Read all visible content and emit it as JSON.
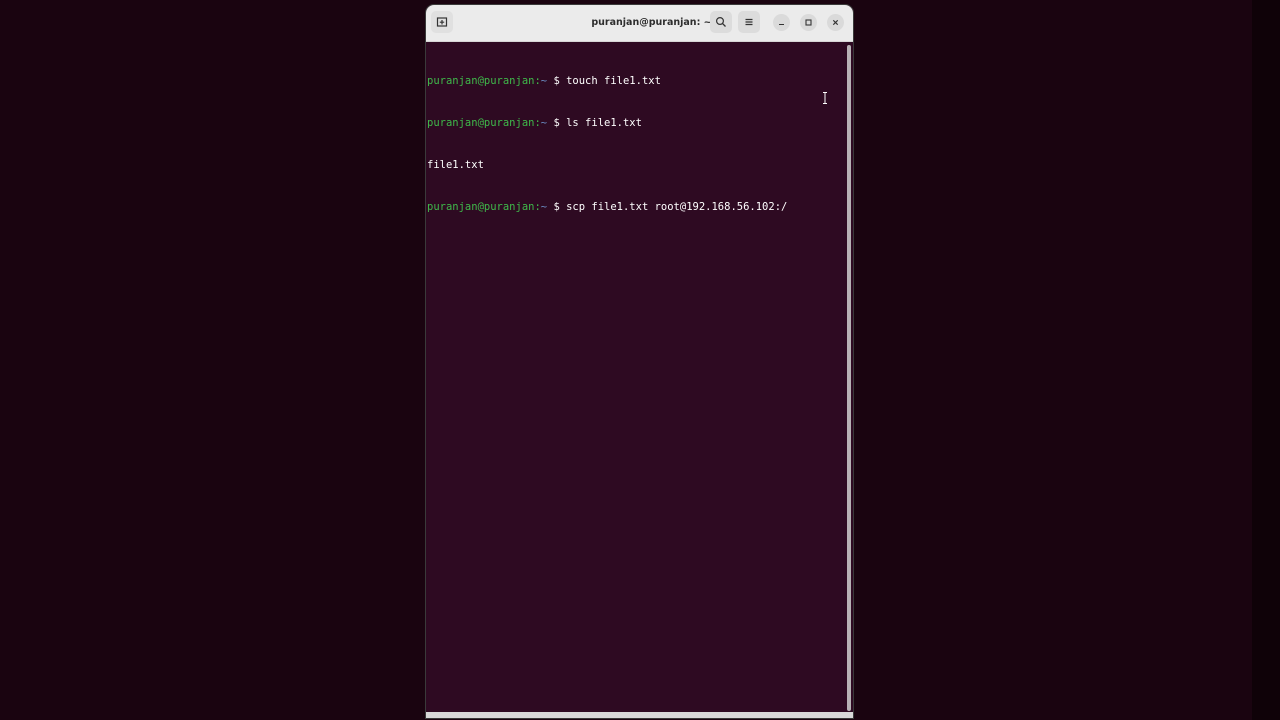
{
  "window": {
    "title": "puranjan@puranjan: ~"
  },
  "terminal": {
    "lines": [
      {
        "type": "prompt",
        "user": "puranjan@puranjan:",
        "path": "~",
        "symbol": " $ ",
        "command": "touch file1.txt"
      },
      {
        "type": "prompt",
        "user": "puranjan@puranjan:",
        "path": "~",
        "symbol": " $ ",
        "command": "ls file1.txt"
      },
      {
        "type": "output",
        "text": "file1.txt"
      },
      {
        "type": "prompt",
        "user": "puranjan@puranjan:",
        "path": "~",
        "symbol": " $ ",
        "command": "scp file1.txt root@192.168.56.102:/"
      }
    ]
  },
  "icons": {
    "new_tab": "new-tab-icon",
    "search": "search-icon",
    "menu": "hamburger-menu-icon",
    "minimize": "minimize-icon",
    "maximize": "maximize-icon",
    "close": "close-icon",
    "cursor": "text-cursor-icon"
  },
  "colors": {
    "terminal_bg": "#2e0a22",
    "prompt_user": "#3fb84a",
    "prompt_path": "#6c8fc7",
    "text": "#ffffff",
    "titlebar": "#ebebeb"
  }
}
